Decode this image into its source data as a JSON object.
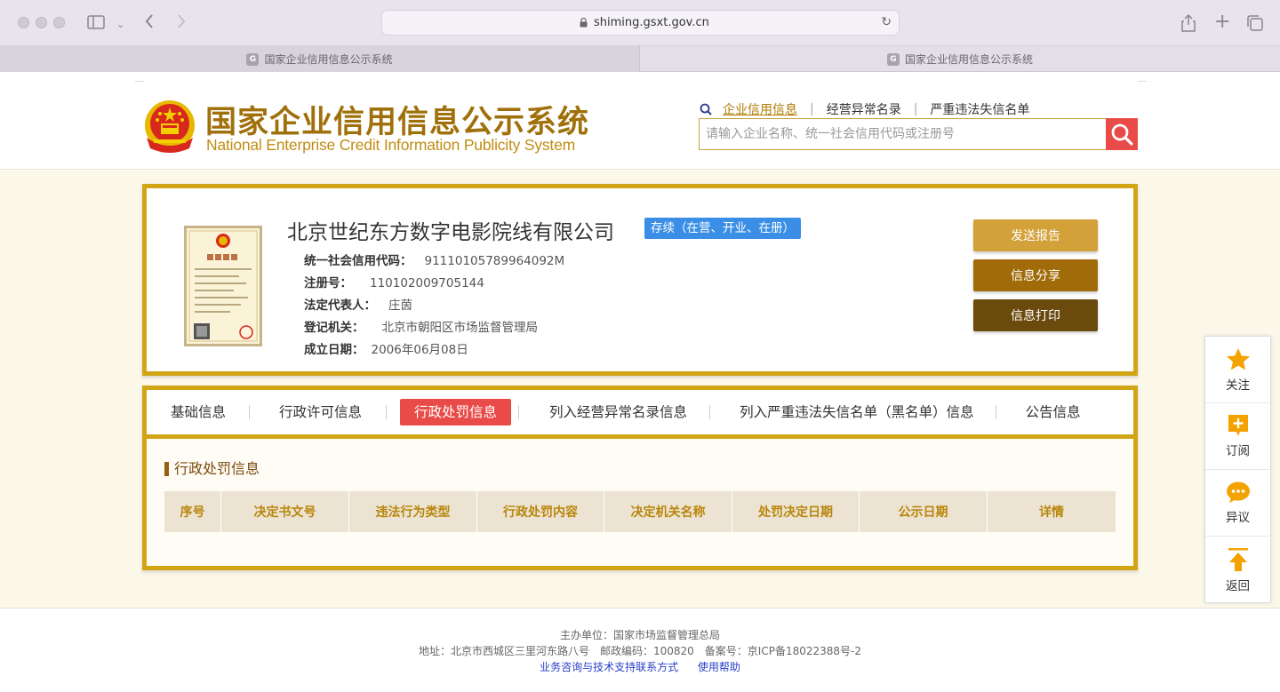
{
  "browser": {
    "url": "shiming.gsxt.gov.cn",
    "tabs": [
      {
        "label": "国家企业信用信息公示系统",
        "favicon": "G"
      },
      {
        "label": "国家企业信用信息公示系统",
        "favicon": "G"
      }
    ]
  },
  "site": {
    "title_cn": "国家企业信用信息公示系统",
    "title_en": "National Enterprise Credit Information Publicity System",
    "nav": [
      "企业信用信息",
      "经营异常名录",
      "严重违法失信名单"
    ],
    "search_placeholder": "请输入企业名称、统一社会信用代码或注册号"
  },
  "company": {
    "name": "北京世纪东方数字电影院线有限公司",
    "status": "存续（在营、开业、在册）",
    "license_title": "营业执照",
    "fields": [
      {
        "label": "统一社会信用代码：",
        "value": "91110105789964092M"
      },
      {
        "label": "注册号：",
        "value": "110102009705144"
      },
      {
        "label": "法定代表人：",
        "value": "庄茵"
      },
      {
        "label": "登记机关：",
        "value": "北京市朝阳区市场监督管理局"
      },
      {
        "label": "成立日期：",
        "value": "2006年06月08日"
      }
    ],
    "actions": [
      {
        "label": "发送报告",
        "color": "#d3a13a"
      },
      {
        "label": "信息分享",
        "color": "#a06b08"
      },
      {
        "label": "信息打印",
        "color": "#6b4a0e"
      }
    ]
  },
  "tabs": {
    "items": [
      "基础信息",
      "行政许可信息",
      "行政处罚信息",
      "列入经营异常名录信息",
      "列入严重违法失信名单（黑名单）信息",
      "公告信息"
    ],
    "active": "行政处罚信息"
  },
  "penalty": {
    "section_title": "行政处罚信息",
    "columns": [
      "序号",
      "决定书文号",
      "违法行为类型",
      "行政处罚内容",
      "决定机关名称",
      "处罚决定日期",
      "公示日期",
      "详情"
    ]
  },
  "float_bar": [
    {
      "label": "关注",
      "icon": "star-icon"
    },
    {
      "label": "订阅",
      "icon": "subscribe-icon"
    },
    {
      "label": "异议",
      "icon": "chat-icon"
    },
    {
      "label": "返回",
      "icon": "back-top-icon"
    }
  ],
  "footer": {
    "host": "主办单位：国家市场监督管理总局",
    "address": "地址：北京市西城区三里河东路八号　邮政编码：100820　备案号：京ICP备18022388号-2",
    "links": [
      "业务咨询与技术支持联系方式",
      "使用帮助"
    ]
  },
  "colors": {
    "gold_border": "#d2a517",
    "active_red": "#e84b48",
    "status_blue": "#3a8ee6",
    "title_gold": "#a0700b"
  }
}
